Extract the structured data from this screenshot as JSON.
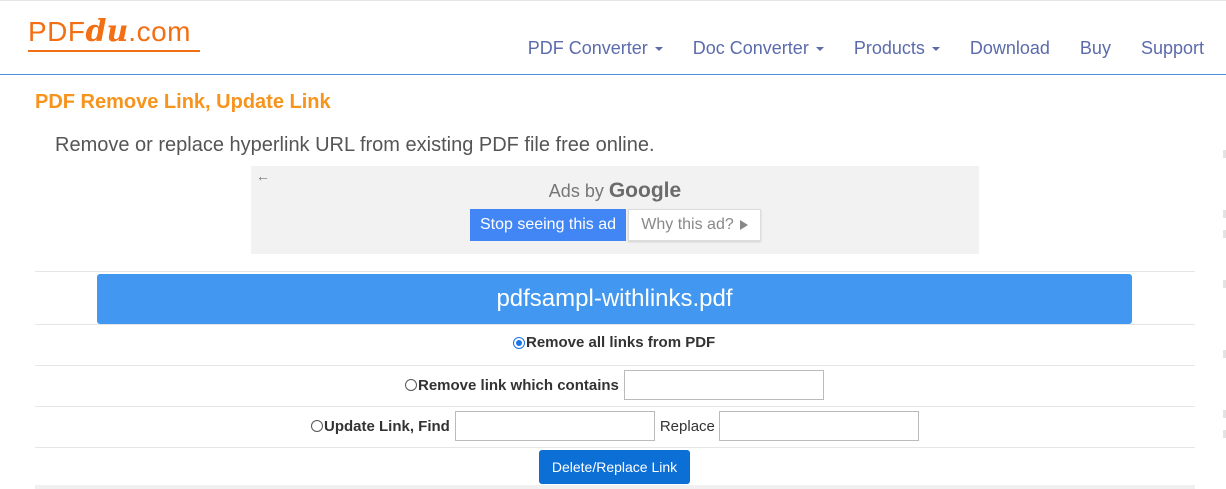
{
  "logo": {
    "part1": "PDF",
    "part2": "du",
    "part3": ".com"
  },
  "nav": {
    "items": [
      {
        "label": "PDF Converter",
        "dropdown": true
      },
      {
        "label": "Doc Converter",
        "dropdown": true
      },
      {
        "label": "Products",
        "dropdown": true
      },
      {
        "label": "Download",
        "dropdown": false
      },
      {
        "label": "Buy",
        "dropdown": false
      },
      {
        "label": "Support",
        "dropdown": false
      }
    ]
  },
  "page": {
    "title": "PDF Remove Link, Update Link",
    "subtitle": "Remove or replace hyperlink URL from existing PDF file free online."
  },
  "ad": {
    "back_icon": "←",
    "ads_by": "Ads by",
    "google": "Google",
    "stop_label": "Stop seeing this ad",
    "why_label": "Why this ad?"
  },
  "form": {
    "file_name": "pdfsampl-withlinks.pdf",
    "option_remove_all": "Remove all links from PDF",
    "option_remove_contains": "Remove link which contains",
    "option_update": "Update Link, Find",
    "replace_label": "Replace",
    "contains_value": "",
    "find_value": "",
    "replace_value": "",
    "selected_option": "remove_all",
    "submit_label": "Delete/Replace Link"
  },
  "colors": {
    "brand_orange": "#f36f14",
    "title_orange": "#f7941d",
    "nav_blue": "#5b6bac",
    "file_bar_blue": "#4297f0",
    "button_blue": "#0b6fd6"
  }
}
